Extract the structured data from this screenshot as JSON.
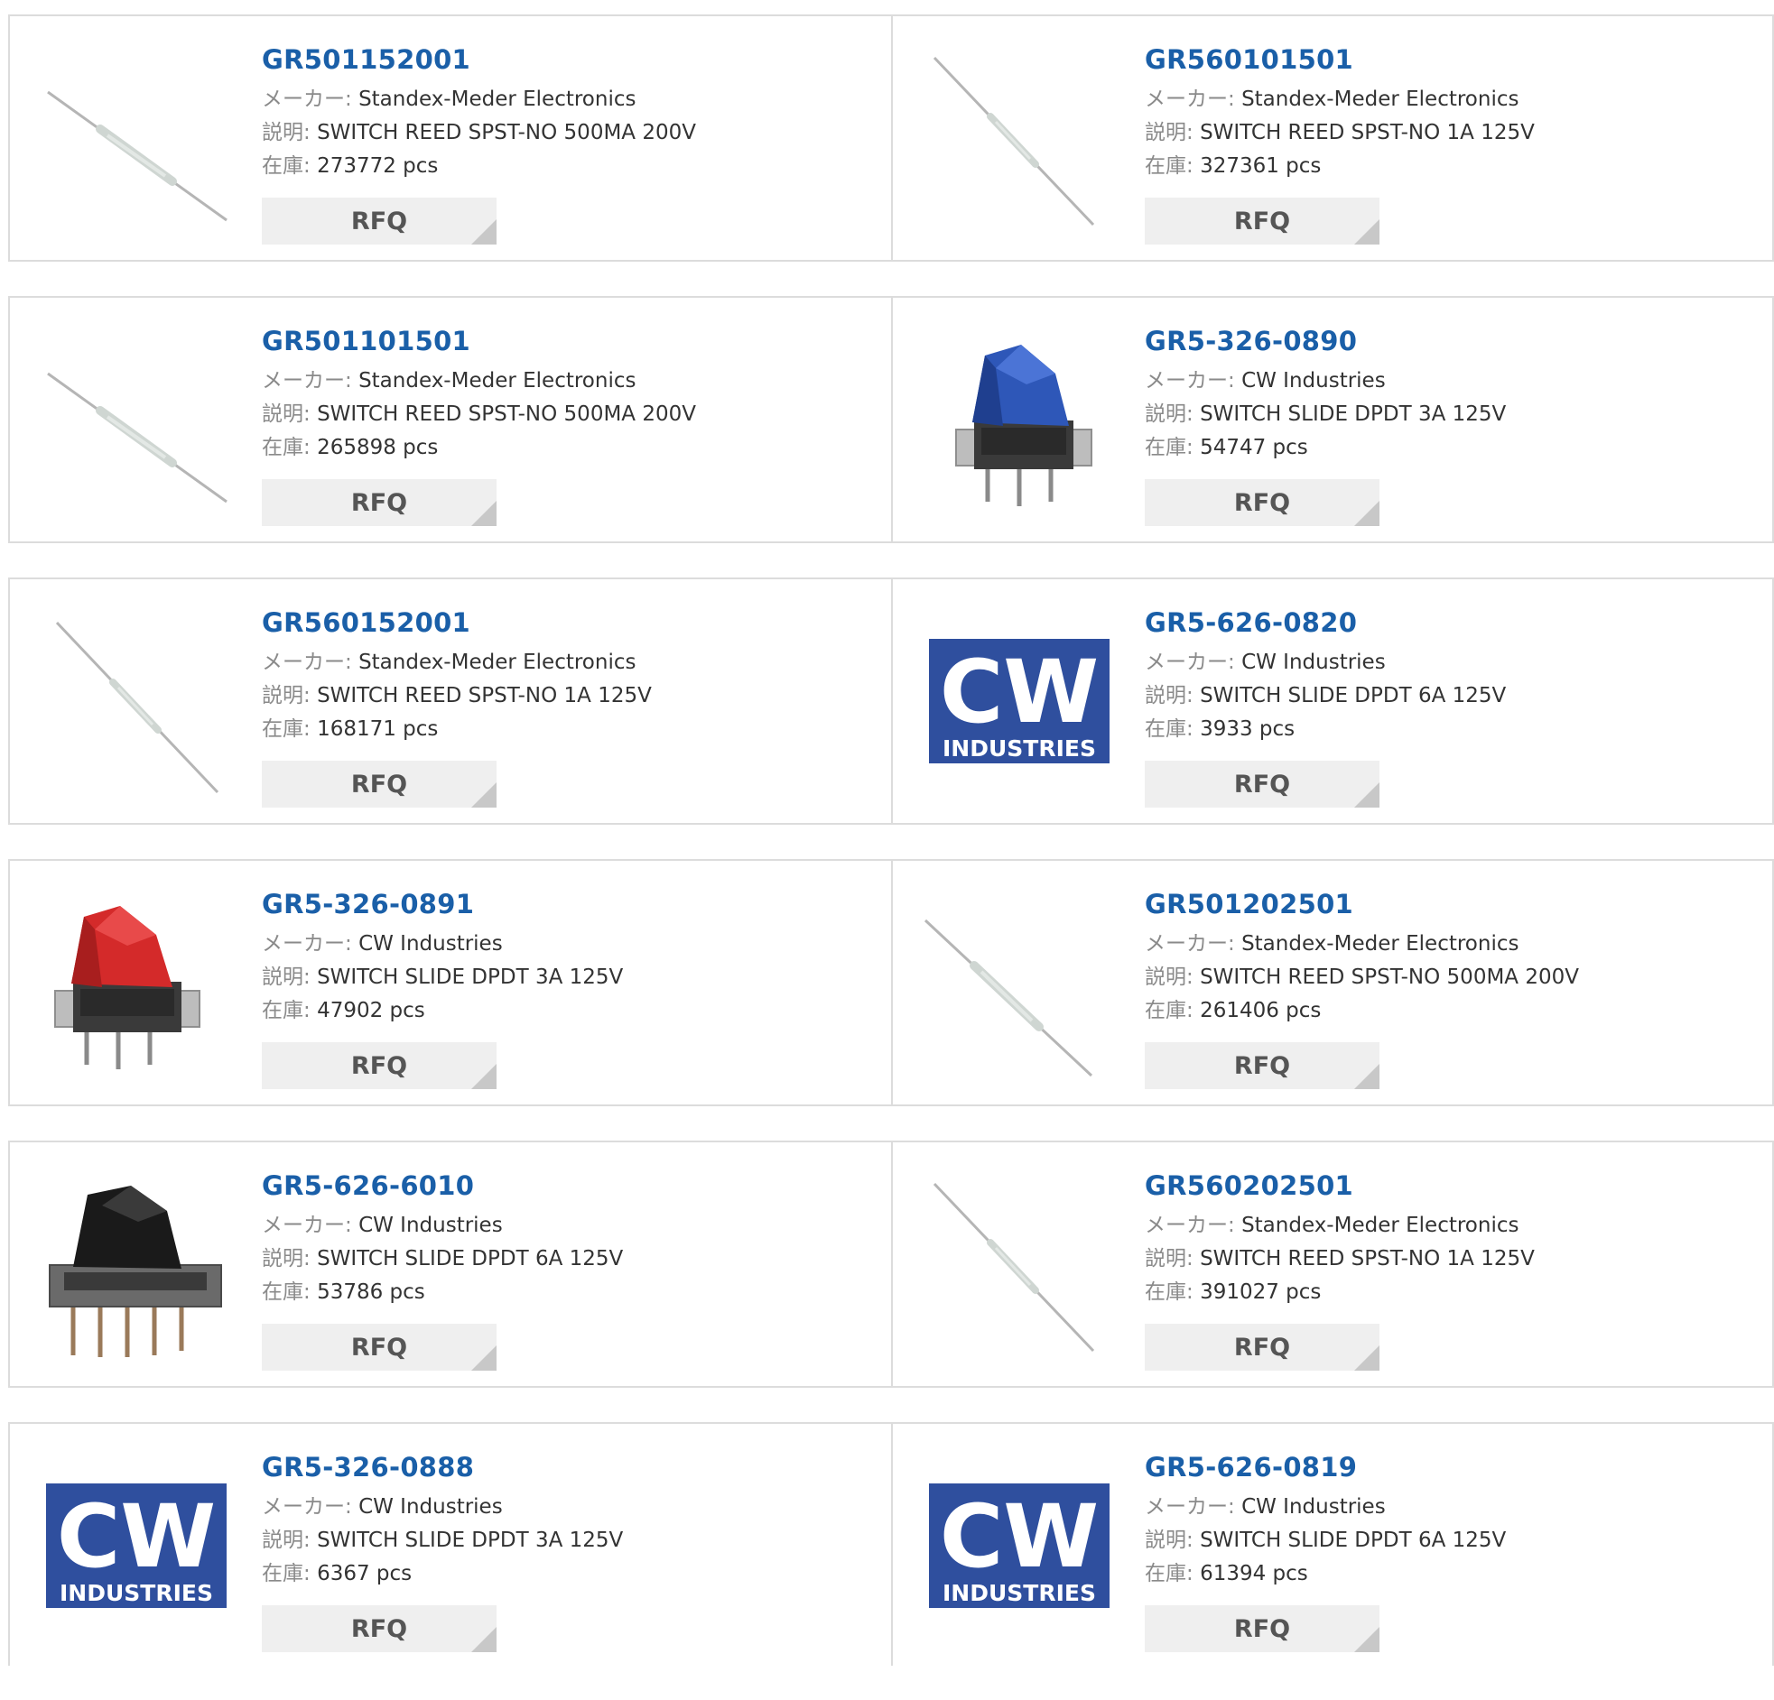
{
  "labels": {
    "maker": "メーカー:",
    "description": "説明:",
    "stock": "在庫:",
    "rfq": "RFQ"
  },
  "products": [
    {
      "part": "GR501152001",
      "maker": "Standex-Meder Electronics",
      "description": "SWITCH REED SPST-NO 500MA 200V",
      "stock": "273772 pcs",
      "thumb": "reed-switch-icon"
    },
    {
      "part": "GR560101501",
      "maker": "Standex-Meder Electronics",
      "description": "SWITCH REED SPST-NO 1A 125V",
      "stock": "327361 pcs",
      "thumb": "reed-switch-icon"
    },
    {
      "part": "GR501101501",
      "maker": "Standex-Meder Electronics",
      "description": "SWITCH REED SPST-NO 500MA 200V",
      "stock": "265898 pcs",
      "thumb": "reed-switch-icon"
    },
    {
      "part": "GR5-326-0890",
      "maker": "CW Industries",
      "description": "SWITCH SLIDE DPDT 3A 125V",
      "stock": "54747 pcs",
      "thumb": "slide-switch-blue-icon"
    },
    {
      "part": "GR560152001",
      "maker": "Standex-Meder Electronics",
      "description": "SWITCH REED SPST-NO 1A 125V",
      "stock": "168171 pcs",
      "thumb": "reed-switch-icon"
    },
    {
      "part": "GR5-626-0820",
      "maker": "CW Industries",
      "description": "SWITCH SLIDE DPDT 6A 125V",
      "stock": "3933 pcs",
      "thumb": "cw-industries-logo"
    },
    {
      "part": "GR5-326-0891",
      "maker": "CW Industries",
      "description": "SWITCH SLIDE DPDT 3A 125V",
      "stock": "47902 pcs",
      "thumb": "slide-switch-red-icon"
    },
    {
      "part": "GR501202501",
      "maker": "Standex-Meder Electronics",
      "description": "SWITCH REED SPST-NO 500MA 200V",
      "stock": "261406 pcs",
      "thumb": "reed-switch-icon"
    },
    {
      "part": "GR5-626-6010",
      "maker": "CW Industries",
      "description": "SWITCH SLIDE DPDT 6A 125V",
      "stock": "53786 pcs",
      "thumb": "slide-switch-black-icon"
    },
    {
      "part": "GR560202501",
      "maker": "Standex-Meder Electronics",
      "description": "SWITCH REED SPST-NO 1A 125V",
      "stock": "391027 pcs",
      "thumb": "reed-switch-icon"
    },
    {
      "part": "GR5-326-0888",
      "maker": "CW Industries",
      "description": "SWITCH SLIDE DPDT 3A 125V",
      "stock": "6367 pcs",
      "thumb": "cw-industries-logo"
    },
    {
      "part": "GR5-626-0819",
      "maker": "CW Industries",
      "description": "SWITCH SLIDE DPDT 6A 125V",
      "stock": "61394 pcs",
      "thumb": "cw-industries-logo"
    }
  ],
  "logo": {
    "letters": "CW",
    "subtitle": "INDUSTRIES",
    "bg_color": "#2f4f9e"
  },
  "colors": {
    "link": "#1a5fa8",
    "slide_blue": "#2e57b8",
    "slide_red": "#d42a2a",
    "slide_black": "#1a1a1a"
  }
}
